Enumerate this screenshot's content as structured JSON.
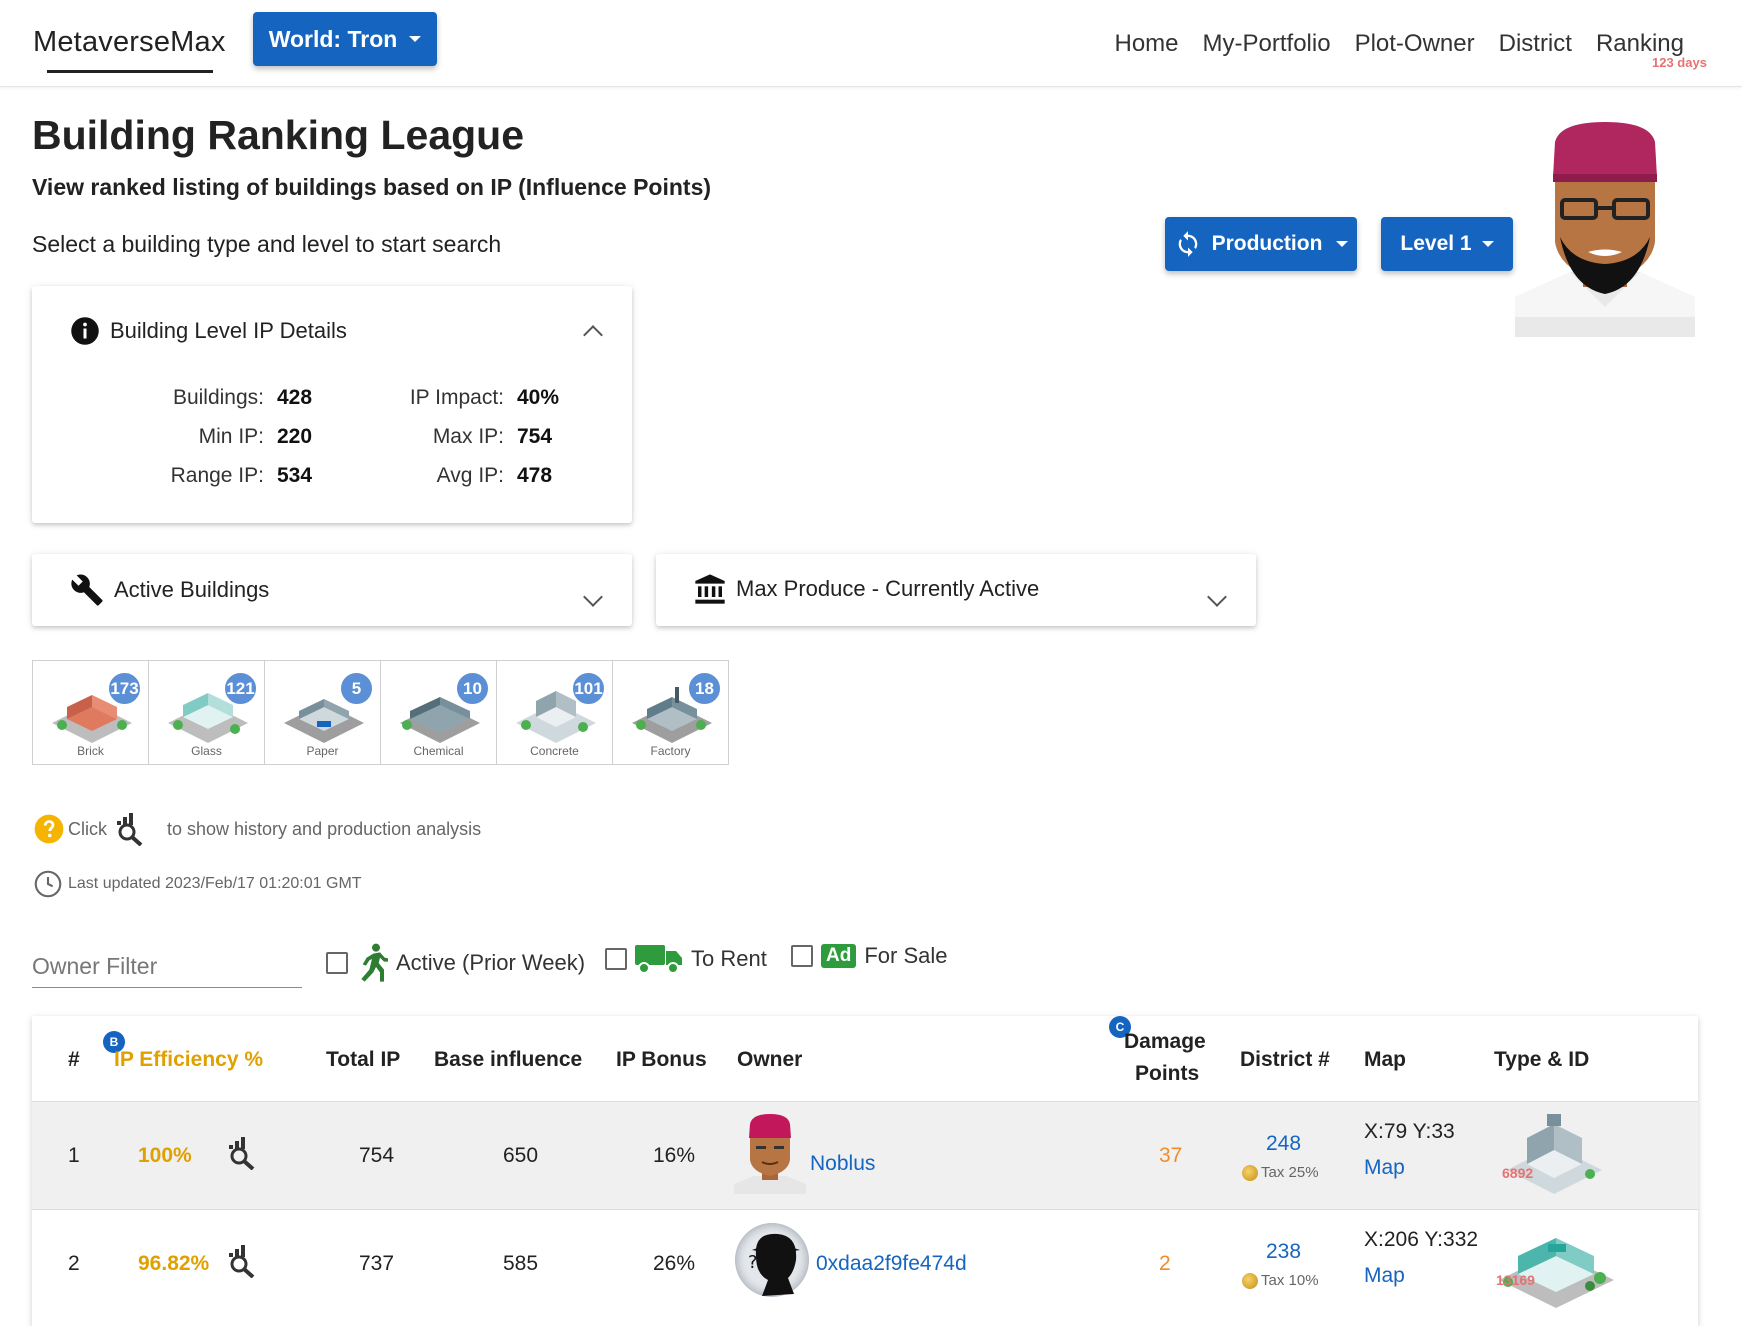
{
  "nav": {
    "brand": "MetaverseMax",
    "world_button": "World: Tron",
    "links": [
      "Home",
      "My-Portfolio",
      "Plot-Owner",
      "District",
      "Ranking"
    ],
    "ranking_badge": "123 days"
  },
  "header": {
    "title": "Building Ranking League",
    "subtitle": "View ranked listing of buildings based on IP (Influence Points)",
    "hint": "Select a building type and level to start search",
    "type_button": "Production",
    "level_button": "Level 1"
  },
  "ip_card": {
    "title": "Building Level IP Details",
    "buildings_label": "Buildings:",
    "buildings": "428",
    "min_label": "Min IP:",
    "min": "220",
    "range_label": "Range IP:",
    "range": "534",
    "impact_label": "IP Impact:",
    "impact": "40%",
    "max_label": "Max IP:",
    "max": "754",
    "avg_label": "Avg IP:",
    "avg": "478"
  },
  "active_card": {
    "title": "Active Buildings"
  },
  "produce_card": {
    "title": "Max Produce - Currently Active"
  },
  "building_types": [
    {
      "label": "Brick",
      "count": "173"
    },
    {
      "label": "Glass",
      "count": "121"
    },
    {
      "label": "Paper",
      "count": "5"
    },
    {
      "label": "Chemical",
      "count": "10"
    },
    {
      "label": "Concrete",
      "count": "101"
    },
    {
      "label": "Factory",
      "count": "18"
    }
  ],
  "info": {
    "click": "Click",
    "analysis": "to show history and production analysis",
    "updated": "Last updated 2023/Feb/17 01:20:01 GMT"
  },
  "filters": {
    "owner_placeholder": "Owner Filter",
    "active": "Active (Prior Week)",
    "rent": "To Rent",
    "sale": "For Sale",
    "ad_icon_text": "Ad"
  },
  "table": {
    "headers": {
      "rank": "#",
      "efficiency": "IP Efficiency %",
      "efficiency_badge": "B",
      "total_ip": "Total IP",
      "base": "Base influence",
      "bonus": "IP Bonus",
      "owner": "Owner",
      "damage_line1": "Damage",
      "damage_line2": "Points",
      "damage_badge": "C",
      "district": "District #",
      "map": "Map",
      "type_id": "Type & ID"
    },
    "rows": [
      {
        "rank": "1",
        "efficiency": "100%",
        "total_ip": "754",
        "base": "650",
        "bonus": "16%",
        "owner": "Noblus",
        "damage": "37",
        "district": "248",
        "tax": "Tax 25%",
        "coords": "X:79 Y:33",
        "map": "Map",
        "building_id": "6892"
      },
      {
        "rank": "2",
        "efficiency": "96.82%",
        "total_ip": "737",
        "base": "585",
        "bonus": "26%",
        "owner": "0xdaa2f9fe474d",
        "damage": "2",
        "district": "238",
        "tax": "Tax 10%",
        "coords": "X:206 Y:332",
        "map": "Map",
        "building_id": "13169"
      }
    ]
  },
  "colors": {
    "primary": "#1565c0",
    "efficiency": "#e0a000",
    "damage": "#f08c2a",
    "badge": "#5b8fd6",
    "id_red": "#e57373"
  }
}
